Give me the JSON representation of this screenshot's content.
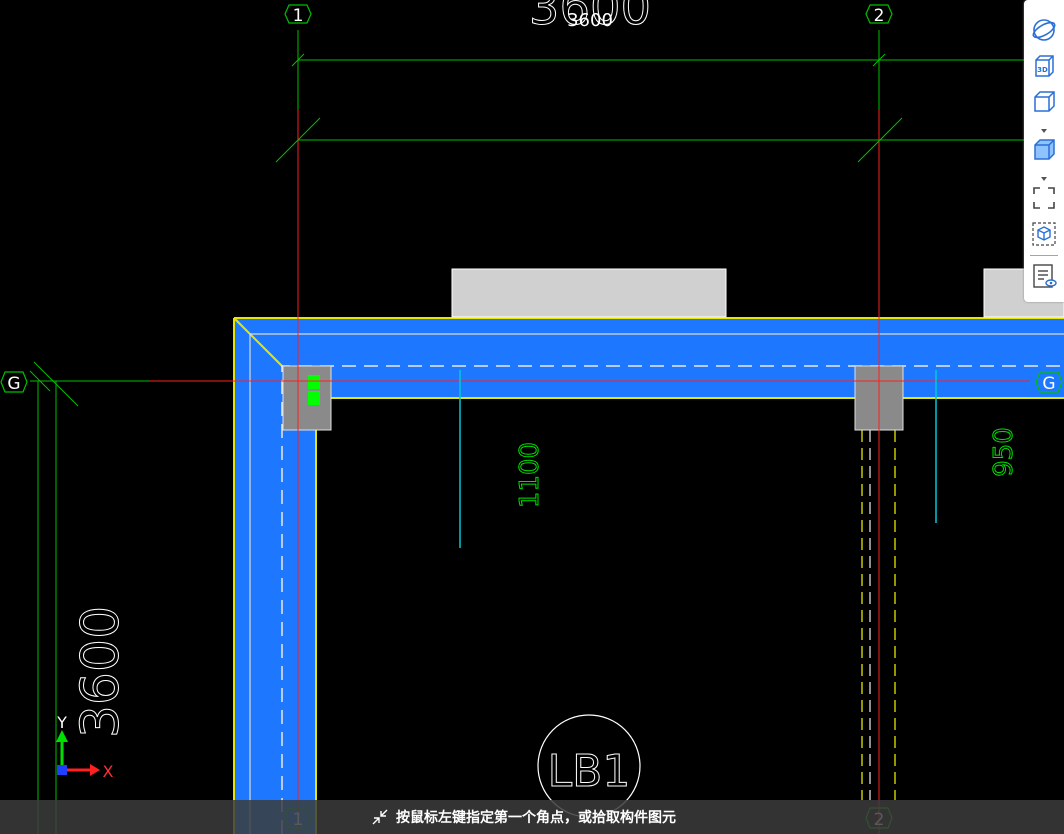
{
  "axes": {
    "col_1": "1",
    "col_2": "2",
    "row_g": "G"
  },
  "dimensions": {
    "top_large": "3600",
    "top_small": "3600",
    "left_vertical": "3600",
    "slab_span_1": "1100",
    "slab_span_2": "950"
  },
  "slab_label": "LB1",
  "ucs": {
    "x_label": "X",
    "y_label": "Y"
  },
  "toolbar": {
    "items": [
      "orbit-icon",
      "view-3d-icon",
      "box-view-icon",
      "shaded-view-icon",
      "fit-extent-icon",
      "select-view-icon",
      "properties-view-icon"
    ]
  },
  "status": {
    "prompt": "按鼠标左键指定第一个角点，或拾取构件图元"
  },
  "colors": {
    "background": "#000000",
    "beam_fill": "#1e78ff",
    "beam_edge": "#e6e600",
    "axis_line": "#ff2020",
    "dim_line": "#00c000",
    "column_fill": "#8a8a8a"
  }
}
